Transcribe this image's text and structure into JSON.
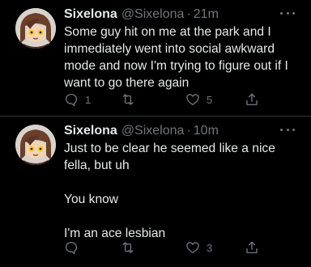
{
  "tweets": [
    {
      "author": {
        "name": "Sixelona",
        "handle": "@Sixelona"
      },
      "separator": "·",
      "time": "21m",
      "lines": [
        "Some guy hit on me at the park and I",
        "immediately went into social awkward",
        "mode and now I'm trying to figure out if I",
        "want to go there again"
      ],
      "reply_count": "1",
      "retweet_count": "",
      "like_count": "5"
    },
    {
      "author": {
        "name": "Sixelona",
        "handle": "@Sixelona"
      },
      "separator": "·",
      "time": "10m",
      "lines": [
        "Just to be clear he seemed like a nice",
        "fella, but uh",
        "",
        "You know",
        "",
        "I'm an ace lesbian"
      ],
      "reply_count": "",
      "retweet_count": "",
      "like_count": "3"
    }
  ],
  "icons": {
    "reply": "reply-icon",
    "retweet": "retweet-icon",
    "like": "heart-icon",
    "share": "share-icon",
    "more": "more-options-icon",
    "avatar": "avatar"
  },
  "colors": {
    "background": "#000000",
    "text": "#e7e9ea",
    "secondary": "#71767b",
    "divider": "#2f3336"
  }
}
